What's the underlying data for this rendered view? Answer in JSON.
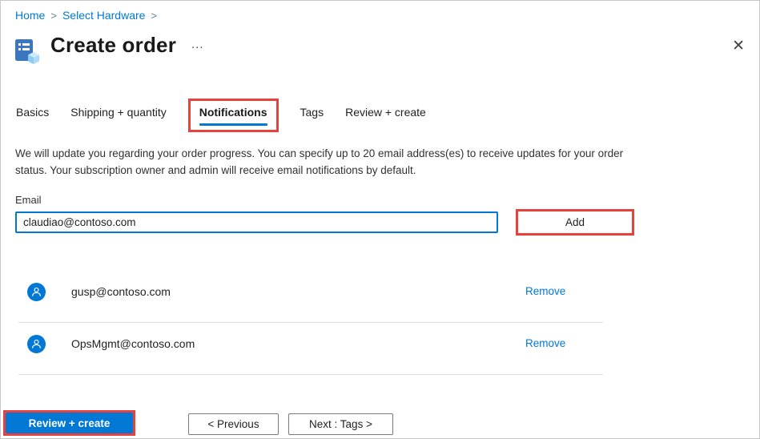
{
  "breadcrumb": {
    "items": [
      {
        "label": "Home"
      },
      {
        "label": "Select Hardware"
      }
    ],
    "separator": ">"
  },
  "header": {
    "title": "Create order",
    "ellipsis": "...",
    "close_glyph": "✕"
  },
  "tabs": [
    {
      "label": "Basics",
      "active": false
    },
    {
      "label": "Shipping + quantity",
      "active": false
    },
    {
      "label": "Notifications",
      "active": true,
      "annotated": true
    },
    {
      "label": "Tags",
      "active": false
    },
    {
      "label": "Review + create",
      "active": false
    }
  ],
  "description": "We will update you regarding your order progress. You can specify up to 20 email address(es) to receive updates for your order status. Your subscription owner and admin will receive email notifications by default.",
  "email_form": {
    "label": "Email",
    "value": "claudiao@contoso.com",
    "add_button": "Add"
  },
  "email_list": [
    {
      "email": "gusp@contoso.com",
      "remove_label": "Remove"
    },
    {
      "email": "OpsMgmt@contoso.com",
      "remove_label": "Remove"
    }
  ],
  "footer": {
    "review_create": "Review + create",
    "previous": "< Previous",
    "next": "Next : Tags >"
  },
  "colors": {
    "accent": "#0078d4",
    "annotation_red": "#e8413c",
    "link": "#0078d4"
  }
}
